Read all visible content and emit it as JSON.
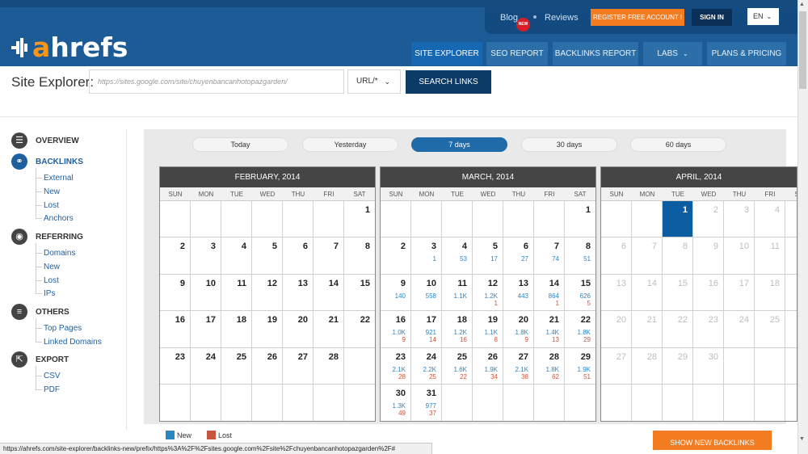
{
  "header": {
    "logo": {
      "a": "a",
      "rest": "hrefs"
    },
    "blog": "Blog",
    "new_badge": "NEW",
    "reviews": "Reviews",
    "register": "REGISTER FREE ACCOUNT !",
    "signin": "SIGN IN",
    "lang": "EN",
    "tabs": [
      "SITE EXPLORER",
      "SEO REPORT",
      "BACKLINKS REPORT",
      "LABS",
      "PLANS & PRICING"
    ],
    "colors": {
      "bar": "#1c5b96",
      "accent": "#f47c20"
    }
  },
  "search": {
    "label": "Site Explorer:",
    "url": "https://sites.google.com/site/chuyenbancanhotopazgarden/",
    "mode": "URL/*",
    "button": "SEARCH LINKS"
  },
  "sidebar": {
    "overview": "OVERVIEW",
    "backlinks": "BACKLINKS",
    "backlinks_items": [
      "External",
      "New",
      "Lost",
      "Anchors"
    ],
    "referring": "REFERRING",
    "referring_items": [
      "Domains",
      "New",
      "Lost",
      "IPs"
    ],
    "others": "OTHERS",
    "others_items": [
      "Top Pages",
      "Linked Domains"
    ],
    "export": "EXPORT",
    "export_items": [
      "CSV",
      "PDF"
    ]
  },
  "periods": [
    "Today",
    "Yesterday",
    "7 days",
    "30 days",
    "60 days"
  ],
  "active_period": "7 days",
  "dow": [
    "SUN",
    "MON",
    "TUE",
    "WED",
    "THU",
    "FRI",
    "SAT"
  ],
  "months": [
    {
      "title": "FEBRUARY, 2014",
      "weeks": [
        [
          null,
          null,
          null,
          null,
          null,
          null,
          {
            "d": "1"
          }
        ],
        [
          {
            "d": "2"
          },
          {
            "d": "3"
          },
          {
            "d": "4"
          },
          {
            "d": "5"
          },
          {
            "d": "6"
          },
          {
            "d": "7"
          },
          {
            "d": "8"
          }
        ],
        [
          {
            "d": "9"
          },
          {
            "d": "10"
          },
          {
            "d": "11"
          },
          {
            "d": "12"
          },
          {
            "d": "13"
          },
          {
            "d": "14"
          },
          {
            "d": "15"
          }
        ],
        [
          {
            "d": "16"
          },
          {
            "d": "17"
          },
          {
            "d": "18"
          },
          {
            "d": "19"
          },
          {
            "d": "20"
          },
          {
            "d": "21"
          },
          {
            "d": "22"
          }
        ],
        [
          {
            "d": "23"
          },
          {
            "d": "24"
          },
          {
            "d": "25"
          },
          {
            "d": "26"
          },
          {
            "d": "27"
          },
          {
            "d": "28"
          },
          null
        ],
        [
          null,
          null,
          null,
          null,
          null,
          null,
          null
        ]
      ]
    },
    {
      "title": "MARCH, 2014",
      "weeks": [
        [
          null,
          null,
          null,
          null,
          null,
          null,
          {
            "d": "1"
          }
        ],
        [
          {
            "d": "2"
          },
          {
            "d": "3",
            "n": "1"
          },
          {
            "d": "4",
            "n": "53"
          },
          {
            "d": "5",
            "n": "17"
          },
          {
            "d": "6",
            "n": "27"
          },
          {
            "d": "7",
            "n": "74"
          },
          {
            "d": "8",
            "n": "51"
          }
        ],
        [
          {
            "d": "9",
            "n": "140"
          },
          {
            "d": "10",
            "n": "558"
          },
          {
            "d": "11",
            "n": "1.1K"
          },
          {
            "d": "12",
            "n": "1.2K",
            "l": "1"
          },
          {
            "d": "13",
            "n": "443"
          },
          {
            "d": "14",
            "n": "864",
            "l": "1"
          },
          {
            "d": "15",
            "n": "626",
            "l": "5"
          }
        ],
        [
          {
            "d": "16",
            "n": "1.0K",
            "l": "9"
          },
          {
            "d": "17",
            "n": "921",
            "l": "14"
          },
          {
            "d": "18",
            "n": "1.2K",
            "l": "16"
          },
          {
            "d": "19",
            "n": "1.1K",
            "l": "8"
          },
          {
            "d": "20",
            "n": "1.8K",
            "l": "9"
          },
          {
            "d": "21",
            "n": "1.4K",
            "l": "13"
          },
          {
            "d": "22",
            "n": "1.8K",
            "l": "29"
          }
        ],
        [
          {
            "d": "23",
            "n": "2.1K",
            "l": "28"
          },
          {
            "d": "24",
            "n": "2.2K",
            "l": "25"
          },
          {
            "d": "25",
            "n": "1.6K",
            "l": "22"
          },
          {
            "d": "26",
            "n": "1.9K",
            "l": "34"
          },
          {
            "d": "27",
            "n": "2.1K",
            "l": "38"
          },
          {
            "d": "28",
            "n": "1.8K",
            "l": "62"
          },
          {
            "d": "29",
            "n": "1.9K",
            "l": "51"
          }
        ],
        [
          {
            "d": "30",
            "n": "1.3K",
            "l": "49"
          },
          {
            "d": "31",
            "n": "977",
            "l": "37"
          },
          null,
          null,
          null,
          null,
          null
        ]
      ]
    },
    {
      "title": "APRIL, 2014",
      "weeks": [
        [
          null,
          null,
          {
            "d": "1",
            "today": true
          },
          {
            "d": "2",
            "m": true
          },
          {
            "d": "3",
            "m": true
          },
          {
            "d": "4",
            "m": true
          },
          {
            "d": "5",
            "m": true
          }
        ],
        [
          {
            "d": "6",
            "m": true
          },
          {
            "d": "7",
            "m": true
          },
          {
            "d": "8",
            "m": true
          },
          {
            "d": "9",
            "m": true
          },
          {
            "d": "10",
            "m": true
          },
          {
            "d": "11",
            "m": true
          },
          {
            "d": "12",
            "m": true
          }
        ],
        [
          {
            "d": "13",
            "m": true
          },
          {
            "d": "14",
            "m": true
          },
          {
            "d": "15",
            "m": true
          },
          {
            "d": "16",
            "m": true
          },
          {
            "d": "17",
            "m": true
          },
          {
            "d": "18",
            "m": true
          },
          {
            "d": "19",
            "m": true
          }
        ],
        [
          {
            "d": "20",
            "m": true
          },
          {
            "d": "21",
            "m": true
          },
          {
            "d": "22",
            "m": true
          },
          {
            "d": "23",
            "m": true
          },
          {
            "d": "24",
            "m": true
          },
          {
            "d": "25",
            "m": true
          },
          {
            "d": "26",
            "m": true
          }
        ],
        [
          {
            "d": "27",
            "m": true
          },
          {
            "d": "28",
            "m": true
          },
          {
            "d": "29",
            "m": true
          },
          {
            "d": "30",
            "m": true
          },
          null,
          null,
          null
        ],
        [
          null,
          null,
          null,
          null,
          null,
          null,
          null
        ]
      ]
    }
  ],
  "legend": {
    "new": "New",
    "lost": "Lost",
    "new_color": "#2b86bf",
    "lost_color": "#c8553d"
  },
  "show_new": "SHOW NEW BACKLINKS",
  "status_url": "https://ahrefs.com/site-explorer/backlinks-new/prefix/https%3A%2F%2Fsites.google.com%2Fsite%2Fchuyenbancanhotopazgarden%2F#"
}
